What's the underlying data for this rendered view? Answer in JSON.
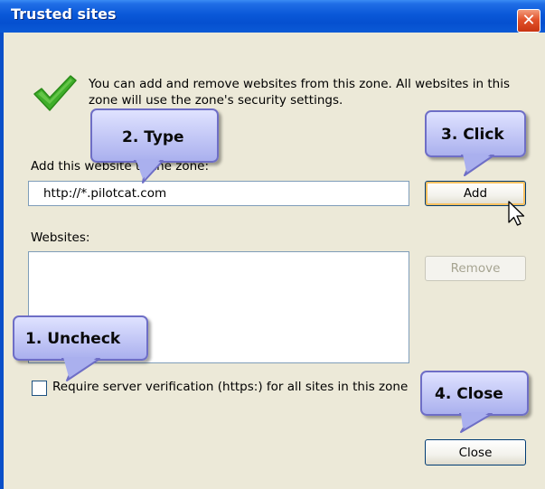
{
  "window": {
    "title": "Trusted sites"
  },
  "controls": {
    "close_icon": "close-icon"
  },
  "info": {
    "text": "You can add and remove websites from this zone. All websites in this zone will use the zone's security settings.",
    "icon": "green-checkmark-icon"
  },
  "add_section": {
    "label": "Add this website to the zone:",
    "url_value": "http://*.pilotcat.com",
    "add_label": "Add"
  },
  "websites_section": {
    "label": "Websites:",
    "remove_label": "Remove"
  },
  "verification": {
    "label": "Require server verification (https:) for all sites in this zone",
    "checked": false
  },
  "footer": {
    "close_label": "Close"
  },
  "callouts": {
    "type": "2. Type",
    "click": "3. Click",
    "uncheck": "1. Uncheck",
    "close": "4.  Close"
  },
  "colors": {
    "titlebar": "#0a58d8",
    "dialog_bg": "#ece9d8",
    "callout_fill": "#aab0ee",
    "callout_border": "#6e6ec6",
    "checkmark": "#3fae2a"
  }
}
